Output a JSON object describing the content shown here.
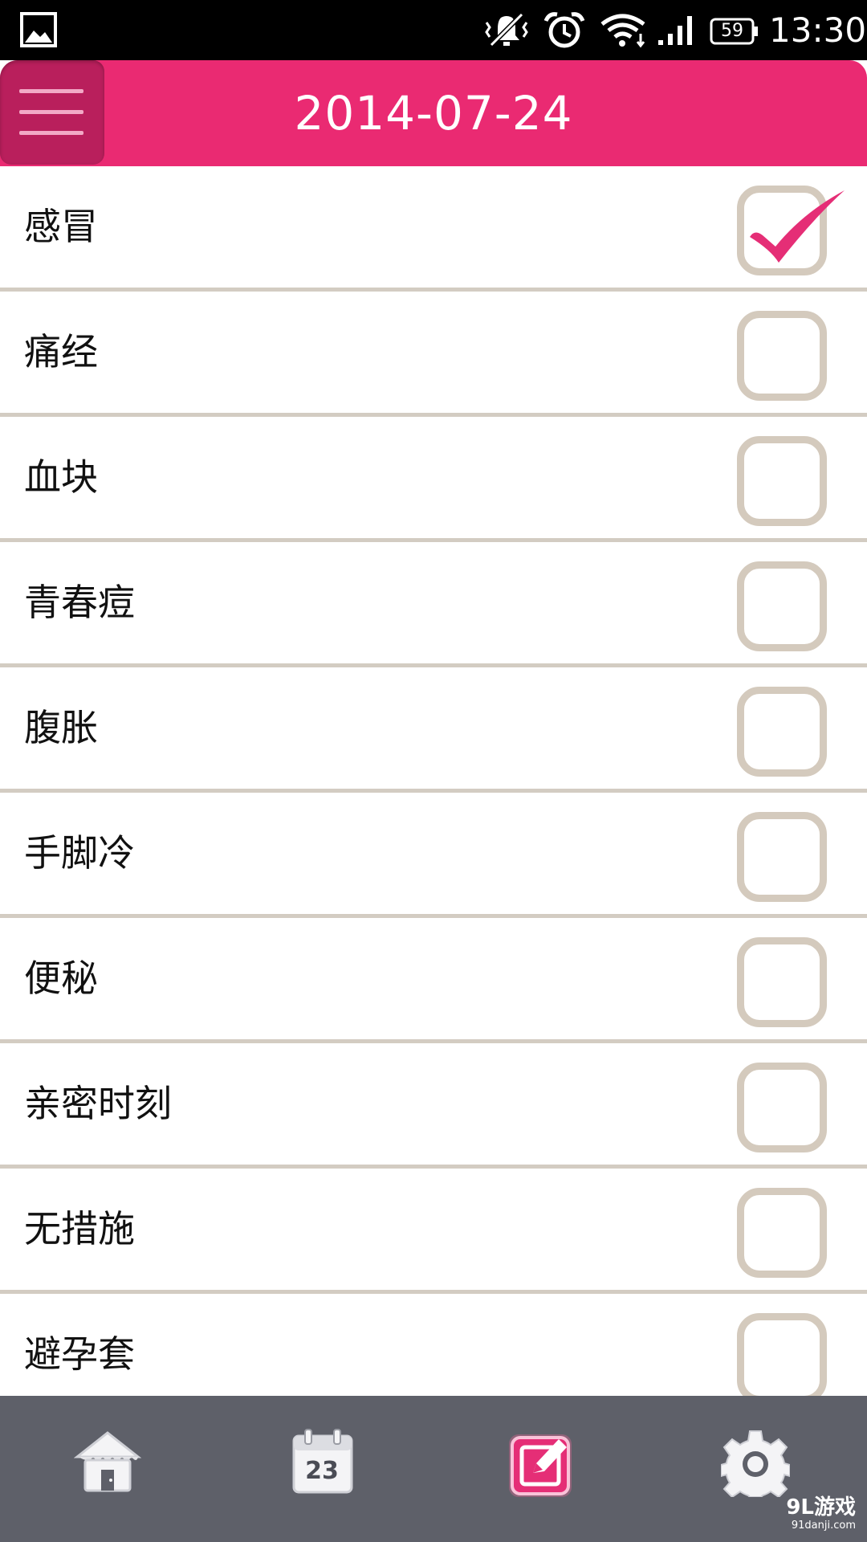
{
  "status_bar": {
    "battery_level": "59",
    "time": "13:30",
    "icons": [
      "gallery-icon",
      "mute-icon",
      "alarm-icon",
      "wifi-icon",
      "signal-icon",
      "battery-icon"
    ]
  },
  "header": {
    "date": "2014-07-24",
    "menu_icon": "hamburger-menu-icon",
    "accent_color": "#ea2a72"
  },
  "symptoms": [
    {
      "label": "感冒",
      "checked": true
    },
    {
      "label": "痛经",
      "checked": false
    },
    {
      "label": "血块",
      "checked": false
    },
    {
      "label": "青春痘",
      "checked": false
    },
    {
      "label": "腹胀",
      "checked": false
    },
    {
      "label": "手脚冷",
      "checked": false
    },
    {
      "label": "便秘",
      "checked": false
    },
    {
      "label": "亲密时刻",
      "checked": false
    },
    {
      "label": "无措施",
      "checked": false
    },
    {
      "label": "避孕套",
      "checked": false
    }
  ],
  "bottom_nav": {
    "tabs": [
      {
        "icon": "home-icon",
        "active": false
      },
      {
        "icon": "calendar-icon",
        "active": false,
        "calendar_day": "23"
      },
      {
        "icon": "edit-note-icon",
        "active": true
      },
      {
        "icon": "gear-icon",
        "active": false
      }
    ]
  },
  "watermark": {
    "main": "9L游戏",
    "sub": "91danji.com"
  }
}
